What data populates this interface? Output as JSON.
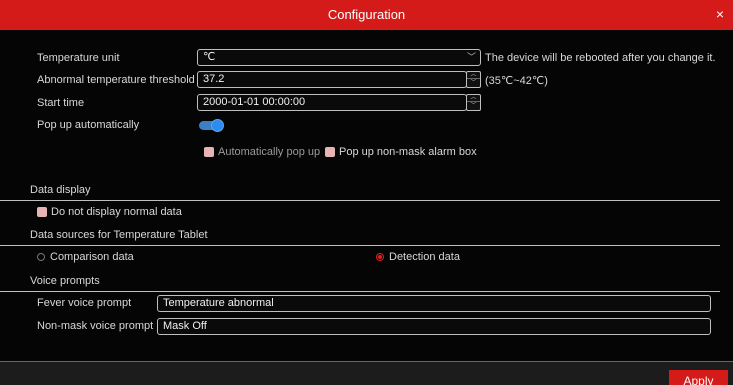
{
  "window": {
    "title": "Configuration",
    "close_icon": "×"
  },
  "form": {
    "temperature_unit": {
      "label": "Temperature unit",
      "value": "℃",
      "note": "The device will be rebooted after you change it."
    },
    "threshold": {
      "label": "Abnormal temperature threshold",
      "value": "37.2",
      "range": "(35℃~42℃)"
    },
    "start_time": {
      "label": "Start time",
      "value": "2000-01-01 00:00:00"
    },
    "popup": {
      "label": "Pop up automatically",
      "enabled": true
    },
    "popup_options": {
      "auto_label": "Automatically pop up",
      "nonmask_label": "Pop up non-mask alarm box"
    }
  },
  "data_display": {
    "header": "Data display",
    "hide_normal_label": "Do not display normal data"
  },
  "data_sources": {
    "header": "Data sources for Temperature Tablet",
    "options": [
      "Comparison data",
      "Detection data"
    ],
    "selected": "Detection data"
  },
  "voice_prompts": {
    "header": "Voice prompts",
    "fever": {
      "label": "Fever voice prompt",
      "value": "Temperature abnormal"
    },
    "nonmask": {
      "label": "Non-mask voice prompt",
      "value": "Mask Off"
    }
  },
  "footer": {
    "apply_label": "Apply"
  },
  "colors": {
    "accent": "#d51a1a",
    "toggle": "#2f8cef",
    "background": "#050505"
  }
}
